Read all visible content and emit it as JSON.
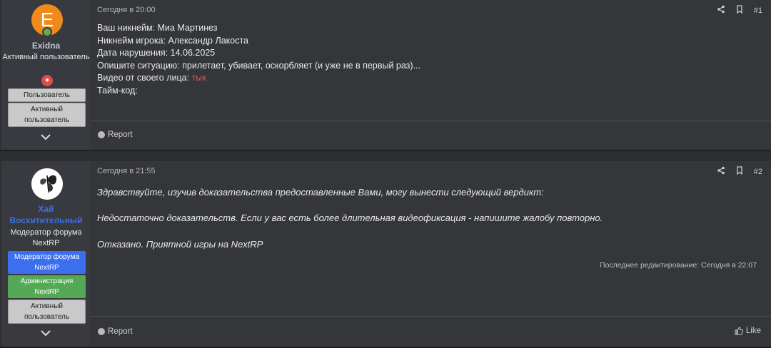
{
  "posts": [
    {
      "user": {
        "avatar_letter": "E",
        "name": "Exidna",
        "name_color": "#b9c7d6",
        "title": "Активный пользователь",
        "banners": [
          "Пользователь",
          "Активный пользователь"
        ]
      },
      "date": "Сегодня в 20:00",
      "number": "#1",
      "lines": [
        "Ваш никнейм: Миа Мартинез",
        "Никнейм игрока: Александр Лакоста",
        "Дата нарушения: 14.06.2025",
        "Опишите ситуацию: прилетает, убивает, оскорбляет (и уже не в первый раз)...",
        "Видео от своего лица: ",
        "Тайм-код:"
      ],
      "video_link": "тык",
      "report_label": "Report"
    },
    {
      "user": {
        "name": "Хай Восхитительный",
        "name_color": "#3d6fe8",
        "title": "Модератор форума NextRP",
        "banners": [
          "Модератор форума NextRP",
          "Администрация NextRP",
          "Активный пользователь"
        ]
      },
      "date": "Сегодня в 21:55",
      "number": "#2",
      "lines": [
        "Здравствуйте, изучив доказательства предоставленные Вами, могу вынести следующий вердикт:",
        "Недостаточно доказательств. Если у вас есть более длительная видеофиксация - напишите жалобу повторно.",
        "Отказано. Приятной игры на NextRP"
      ],
      "last_edit": "Последнее редактирование: Сегодня в 22:07",
      "report_label": "Report",
      "like_label": "Like"
    }
  ]
}
